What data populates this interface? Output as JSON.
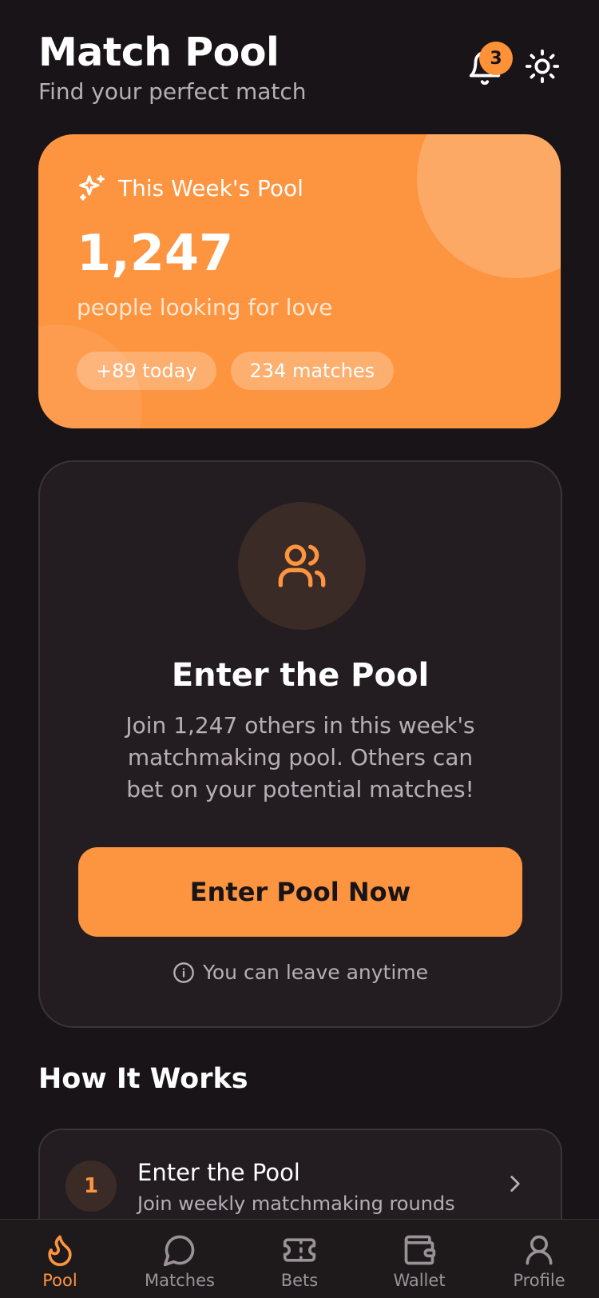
{
  "header": {
    "title": "Match Pool",
    "subtitle": "Find your perfect match",
    "notification_count": "3"
  },
  "pool_card": {
    "label": "This Week's Pool",
    "count": "1,247",
    "description": "people looking for love",
    "chips": [
      "+89 today",
      "234 matches"
    ]
  },
  "enter_card": {
    "title": "Enter the Pool",
    "description": "Join 1,247 others in this week's matchmaking pool. Others can bet on your potential matches!",
    "button_label": "Enter Pool Now",
    "note": "You can leave anytime"
  },
  "how_it_works": {
    "title": "How It Works",
    "steps": [
      {
        "number": "1",
        "title": "Enter the Pool",
        "subtitle": "Join weekly matchmaking rounds"
      }
    ]
  },
  "nav": {
    "items": [
      {
        "label": "Pool",
        "icon": "flame-icon",
        "active": true
      },
      {
        "label": "Matches",
        "icon": "chat-bubble-icon",
        "active": false
      },
      {
        "label": "Bets",
        "icon": "ticket-icon",
        "active": false
      },
      {
        "label": "Wallet",
        "icon": "wallet-icon",
        "active": false
      },
      {
        "label": "Profile",
        "icon": "user-icon",
        "active": false
      }
    ]
  },
  "colors": {
    "accent": "#fd9440",
    "background": "#181417",
    "card": "#231d21",
    "muted_text": "#b7afb4"
  }
}
